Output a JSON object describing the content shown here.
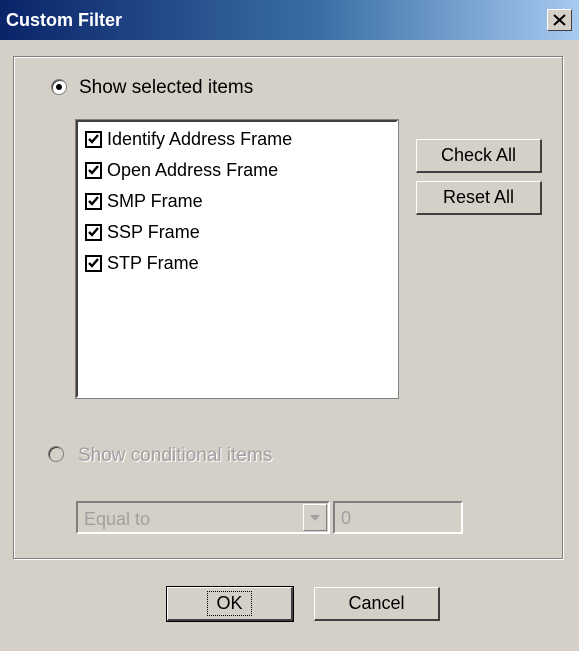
{
  "dialog": {
    "title": "Custom Filter",
    "close_icon": "close-x-icon"
  },
  "filter_mode": {
    "show_selected": {
      "label": "Show selected items",
      "selected": true
    },
    "show_conditional": {
      "label": "Show conditional items",
      "selected": false,
      "enabled": false
    }
  },
  "items": [
    {
      "label": "Identify Address Frame",
      "checked": true
    },
    {
      "label": "Open Address Frame",
      "checked": true
    },
    {
      "label": "SMP Frame",
      "checked": true
    },
    {
      "label": "SSP Frame",
      "checked": true
    },
    {
      "label": "STP Frame",
      "checked": true
    }
  ],
  "buttons": {
    "check_all": "Check All",
    "reset_all": "Reset All",
    "ok": "OK",
    "cancel": "Cancel"
  },
  "condition": {
    "operator": "Equal to",
    "value": "0"
  },
  "colors": {
    "dialog_bg": "#d4d0c8",
    "title_bar_start": "#0a246a",
    "title_bar_end": "#a6caf0",
    "disabled_text": "#a0a0a0"
  }
}
